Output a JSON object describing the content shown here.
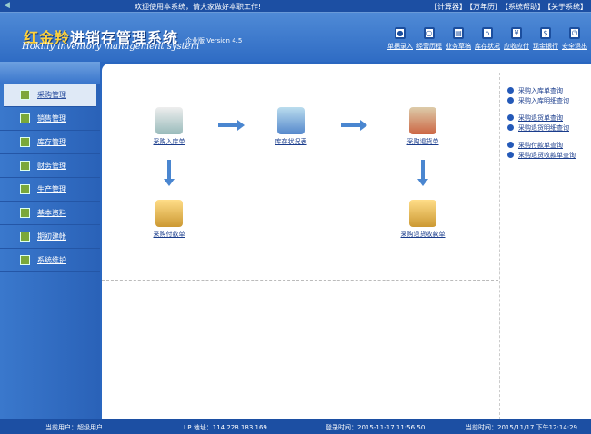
{
  "topbar": {
    "welcome": "欢迎使用本系统，请大家做好本职工作!",
    "links": [
      "【计算器】",
      "【万年历】",
      "【系统帮助】",
      "【关于系统】"
    ]
  },
  "header": {
    "title_hl": "红金羚",
    "title": "进销存管理系统",
    "subtitle": "Hokilly inventory management system",
    "version": "企业版 Version 4.5",
    "tools": [
      {
        "label": "单据录入",
        "icon": "user-icon"
      },
      {
        "label": "经营历程",
        "icon": "search-icon"
      },
      {
        "label": "业务草稿",
        "icon": "clipboard-icon"
      },
      {
        "label": "库存状况",
        "icon": "home-icon"
      },
      {
        "label": "应收应付",
        "icon": "money-bag-icon"
      },
      {
        "label": "现金银行",
        "icon": "dollar-icon"
      },
      {
        "label": "安全退出",
        "icon": "exit-icon"
      }
    ]
  },
  "sidebar": {
    "items": [
      "采购管理",
      "销售管理",
      "库存管理",
      "财务管理",
      "生产管理",
      "基本资料",
      "期初建帐",
      "系统维护"
    ]
  },
  "flow": {
    "purchase_in": "采购入库单",
    "stock": "库存状况表",
    "purchase_return": "采购退货单",
    "purchase_pay": "采购付款单",
    "return_receipt": "采购退货收款单"
  },
  "queries": [
    "采购入库单查询",
    "采购入库明细查询",
    "采购退货单查询",
    "采购退货明细查询",
    "采购付款单查询",
    "采购退货收款单查询"
  ],
  "status": {
    "user": "当前用户：超级用户",
    "ip": "I P 地址：114.228.183.169",
    "login": "登录时间：2015-11-17 11:56:50",
    "now": "当前时间：2015/11/17 下午12:14:29"
  }
}
